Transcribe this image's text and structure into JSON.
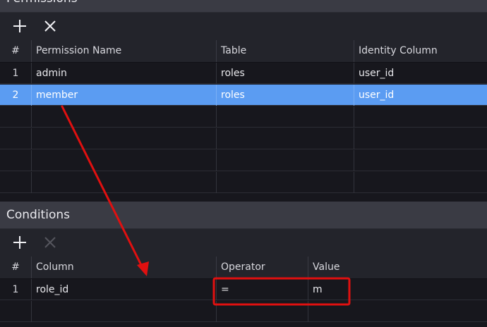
{
  "permissions": {
    "title": "Permissions",
    "toolbar": {
      "add_icon": "plus-icon",
      "remove_icon": "close-icon"
    },
    "columns": [
      "#",
      "Permission Name",
      "Table",
      "Identity Column"
    ],
    "rows": [
      {
        "num": "1",
        "name": "admin",
        "table": "roles",
        "identity": "user_id"
      },
      {
        "num": "2",
        "name": "member",
        "table": "roles",
        "identity": "user_id"
      }
    ]
  },
  "conditions": {
    "title": "Conditions",
    "toolbar": {
      "add_icon": "plus-icon",
      "remove_icon": "close-icon"
    },
    "columns": [
      "#",
      "Column",
      "Operator",
      "Value"
    ],
    "rows": [
      {
        "num": "1",
        "column": "role_id",
        "operator": "=",
        "value": "m"
      }
    ]
  },
  "colors": {
    "selection": "#5b9cf2",
    "annotation": "#e01010"
  }
}
